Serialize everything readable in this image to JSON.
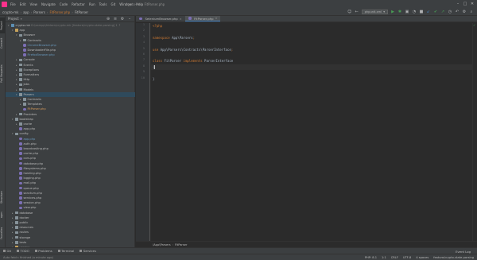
{
  "menubar": {
    "items": [
      "File",
      "Edit",
      "View",
      "Navigate",
      "Code",
      "Refactor",
      "Run",
      "Tools",
      "Git",
      "Window",
      "Help"
    ],
    "window_title": "crypto-mk - FitParser.php"
  },
  "navbar": {
    "crumbs": [
      "crypto-mk",
      "app",
      "Parsers",
      "FitParser.php",
      "FitParser"
    ],
    "run_config": "phpunit.xml"
  },
  "left_strip": {
    "tabs": [
      "Project",
      "Commit",
      "Pull Requests"
    ],
    "bottom_tabs": [
      "Structure",
      "npm",
      "Favorites"
    ]
  },
  "project": {
    "title": "Project",
    "tree": [
      {
        "depth": 0,
        "kind": "folder-blue",
        "label": "crypto-mk",
        "suffix": " D:\\xampp\\htdocs\\crypto-mk [feature/crypto-state-parsing] 1 ↑",
        "open": true
      },
      {
        "depth": 1,
        "kind": "folder-orange",
        "label": "app",
        "open": true
      },
      {
        "depth": 2,
        "kind": "folder",
        "label": "Browser",
        "open": true
      },
      {
        "depth": 3,
        "kind": "folder",
        "label": "Contracts",
        "open": false
      },
      {
        "depth": 3,
        "kind": "php",
        "label": "ChromeBrowser.php",
        "style": "mod"
      },
      {
        "depth": 3,
        "kind": "php",
        "label": "DownloaderFile.php"
      },
      {
        "depth": 3,
        "kind": "php",
        "label": "FirefoxBrowser.php",
        "style": "mod"
      },
      {
        "depth": 2,
        "kind": "folder",
        "label": "Console",
        "open": false
      },
      {
        "depth": 2,
        "kind": "folder",
        "label": "Events",
        "open": false
      },
      {
        "depth": 2,
        "kind": "folder",
        "label": "Exceptions",
        "open": false
      },
      {
        "depth": 2,
        "kind": "folder",
        "label": "Formatters",
        "open": false
      },
      {
        "depth": 2,
        "kind": "folder",
        "label": "Http",
        "open": false
      },
      {
        "depth": 2,
        "kind": "folder",
        "label": "Jobs",
        "open": false
      },
      {
        "depth": 2,
        "kind": "folder",
        "label": "Models",
        "open": false
      },
      {
        "depth": 2,
        "kind": "folder",
        "label": "Parsers",
        "open": true,
        "style": "highlight"
      },
      {
        "depth": 3,
        "kind": "folder",
        "label": "Contracts",
        "open": false
      },
      {
        "depth": 3,
        "kind": "folder",
        "label": "Templates",
        "open": false
      },
      {
        "depth": 3,
        "kind": "php",
        "label": "FitParser.php",
        "style": "orange"
      },
      {
        "depth": 2,
        "kind": "folder",
        "label": "Providers",
        "open": false
      },
      {
        "depth": 1,
        "kind": "folder",
        "label": "bootstrap",
        "open": true
      },
      {
        "depth": 2,
        "kind": "folder",
        "label": "cache",
        "open": false
      },
      {
        "depth": 2,
        "kind": "php",
        "label": "app.php"
      },
      {
        "depth": 1,
        "kind": "folder",
        "label": "config",
        "open": true
      },
      {
        "depth": 2,
        "kind": "php",
        "label": "app.php",
        "style": "mod"
      },
      {
        "depth": 2,
        "kind": "php",
        "label": "auth.php"
      },
      {
        "depth": 2,
        "kind": "php",
        "label": "broadcasting.php"
      },
      {
        "depth": 2,
        "kind": "php",
        "label": "cache.php"
      },
      {
        "depth": 2,
        "kind": "php",
        "label": "cors.php"
      },
      {
        "depth": 2,
        "kind": "php",
        "label": "database.php"
      },
      {
        "depth": 2,
        "kind": "php",
        "label": "filesystems.php"
      },
      {
        "depth": 2,
        "kind": "php",
        "label": "hashing.php"
      },
      {
        "depth": 2,
        "kind": "php",
        "label": "logging.php"
      },
      {
        "depth": 2,
        "kind": "php",
        "label": "mail.php"
      },
      {
        "depth": 2,
        "kind": "php",
        "label": "queue.php"
      },
      {
        "depth": 2,
        "kind": "php",
        "label": "sanctum.php"
      },
      {
        "depth": 2,
        "kind": "php",
        "label": "services.php"
      },
      {
        "depth": 2,
        "kind": "php",
        "label": "session.php"
      },
      {
        "depth": 2,
        "kind": "php",
        "label": "view.php"
      },
      {
        "depth": 1,
        "kind": "folder",
        "label": "database",
        "open": false
      },
      {
        "depth": 1,
        "kind": "folder",
        "label": "docker",
        "open": false
      },
      {
        "depth": 1,
        "kind": "folder",
        "label": "public",
        "open": false
      },
      {
        "depth": 1,
        "kind": "folder",
        "label": "resources",
        "open": false
      },
      {
        "depth": 1,
        "kind": "folder",
        "label": "routes",
        "open": false
      },
      {
        "depth": 1,
        "kind": "folder",
        "label": "storage",
        "open": false
      },
      {
        "depth": 1,
        "kind": "folder",
        "label": "tests",
        "open": false
      },
      {
        "depth": 1,
        "kind": "folder-orange",
        "label": "vendor",
        "open": false,
        "style": "muted"
      }
    ]
  },
  "editor": {
    "tabs": [
      {
        "label": "SeleniumBrowser.php",
        "active": false
      },
      {
        "label": "FitParser.php",
        "active": true
      }
    ],
    "lines": [
      {
        "num": "1",
        "tokens": [
          {
            "t": "<?php",
            "c": "kw"
          }
        ]
      },
      {
        "num": "2",
        "tokens": []
      },
      {
        "num": "3",
        "tokens": [
          {
            "t": "namespace ",
            "c": "kw"
          },
          {
            "t": "App\\Parsers",
            "c": "ns"
          },
          {
            "t": ";",
            "c": "punct"
          }
        ]
      },
      {
        "num": "4",
        "tokens": []
      },
      {
        "num": "5",
        "tokens": [
          {
            "t": "use ",
            "c": "kw"
          },
          {
            "t": "App\\Parsers\\Contracts\\ParserInterface",
            "c": "ns"
          },
          {
            "t": ";",
            "c": "punct"
          }
        ]
      },
      {
        "num": "6",
        "tokens": []
      },
      {
        "num": "7",
        "tokens": [
          {
            "t": "class ",
            "c": "kw"
          },
          {
            "t": "FitParser ",
            "c": "cls"
          },
          {
            "t": "implements ",
            "c": "kw"
          },
          {
            "t": "ParserInterface",
            "c": "cls"
          }
        ]
      },
      {
        "num": "8",
        "tokens": [
          {
            "t": "{",
            "c": "cls"
          }
        ],
        "current": true
      },
      {
        "num": "9",
        "tokens": [
          {
            "t": "",
            "c": "cls"
          }
        ]
      },
      {
        "num": "10",
        "tokens": [
          {
            "t": "}",
            "c": "cls"
          }
        ]
      }
    ],
    "breadcrumb": [
      "\\App\\Parsers",
      "FitParser"
    ]
  },
  "bottom_tabs": {
    "items": [
      "Git",
      "TODO",
      "Problems",
      "Terminal",
      "Services"
    ],
    "event_log": "Event Log"
  },
  "status": {
    "message": "Auto fetch: finished (a minute ago)",
    "right": [
      "PHP: 8.1",
      "1:1",
      "CRLF",
      "UTF-8",
      "4 spaces",
      "feature/crypto-state-parsing"
    ]
  }
}
